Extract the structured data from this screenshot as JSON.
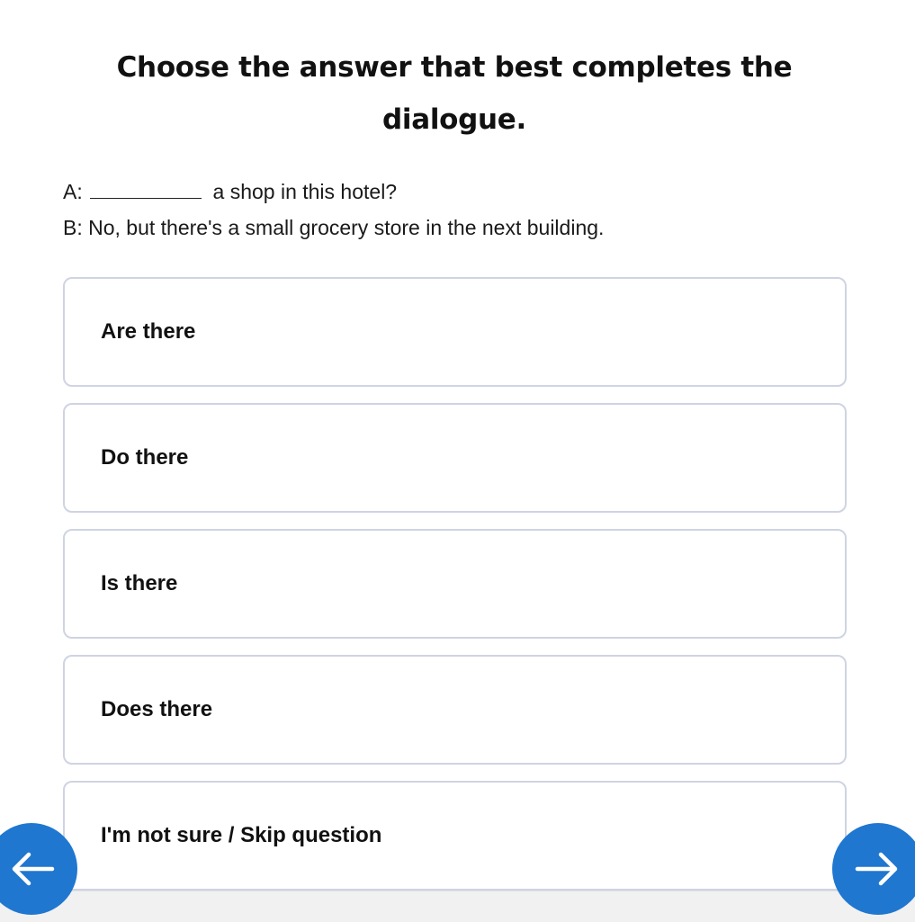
{
  "question": {
    "title": "Choose the answer that best completes the dialogue."
  },
  "dialogue": {
    "line_a_speaker": "A:",
    "line_a_text": "a shop in this hotel?",
    "line_b": "B: No, but there's a small grocery store in the next building."
  },
  "options": [
    {
      "label": "Are there"
    },
    {
      "label": "Do there"
    },
    {
      "label": "Is there"
    },
    {
      "label": "Does there"
    },
    {
      "label": "I'm not sure / Skip question"
    }
  ],
  "navigation": {
    "prev_icon": "arrow-left-icon",
    "next_icon": "arrow-right-icon",
    "accent_color": "#1f77d0"
  }
}
